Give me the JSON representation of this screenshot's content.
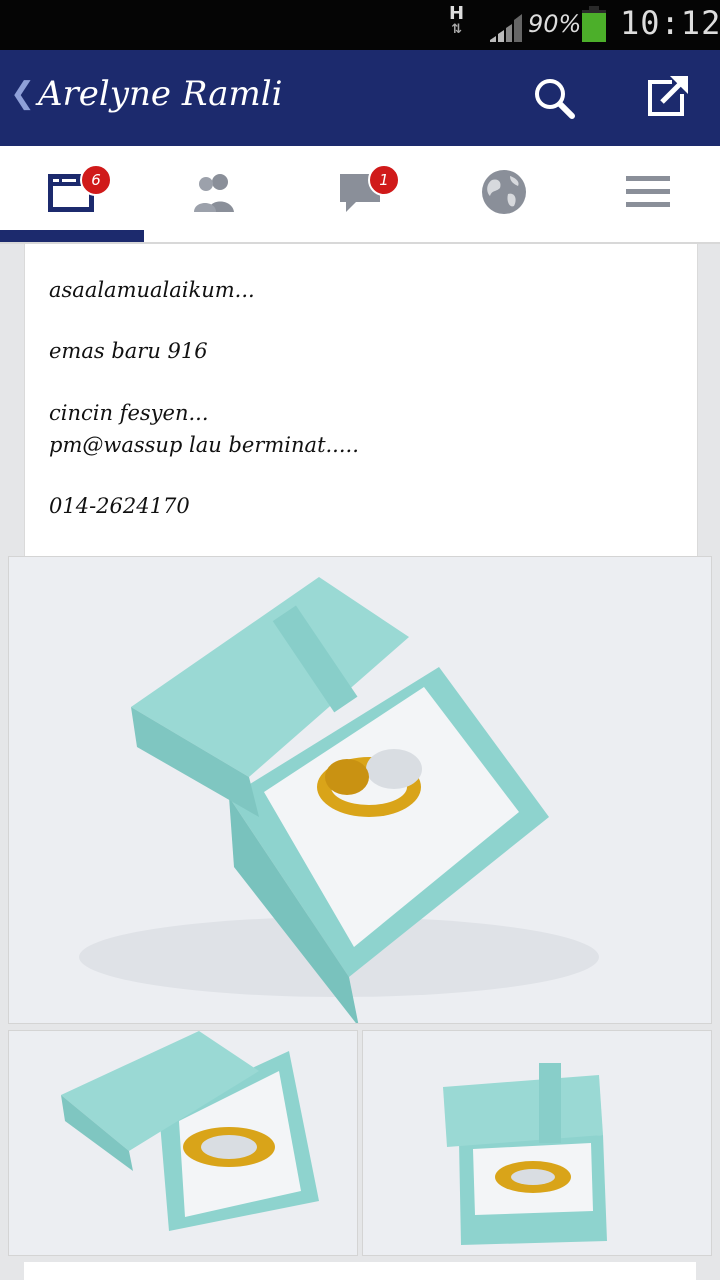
{
  "status_bar": {
    "network_type": "H",
    "battery_percent": "90%",
    "battery_level": 0.9,
    "time": "10:12"
  },
  "header": {
    "back_icon": "chevron-left-icon",
    "title": "Arelyne Ramli",
    "search_icon": "search-icon",
    "share_icon": "share-icon",
    "background_color": "#1c2a6d"
  },
  "tabs": [
    {
      "name": "news-feed",
      "icon": "news-feed-icon",
      "badge": "6",
      "active": true
    },
    {
      "name": "friend-requests",
      "icon": "friends-icon",
      "badge": ""
    },
    {
      "name": "messages",
      "icon": "chat-icon",
      "badge": "1"
    },
    {
      "name": "notifications",
      "icon": "globe-icon",
      "badge": ""
    },
    {
      "name": "more",
      "icon": "menu-icon",
      "badge": ""
    }
  ],
  "post": {
    "lines": [
      "asaalamualaikum...",
      "emas baru 916",
      "cincin fesyen...",
      "pm@wassup lau berminat.....",
      "014-2624170"
    ]
  },
  "photos": [
    {
      "name": "main-photo",
      "subject": "gold ring in turquoise gift box"
    },
    {
      "name": "thumbnail-left",
      "subject": "gold ring in turquoise gift box"
    },
    {
      "name": "thumbnail-right",
      "subject": "gold ring in turquoise gift box"
    }
  ]
}
